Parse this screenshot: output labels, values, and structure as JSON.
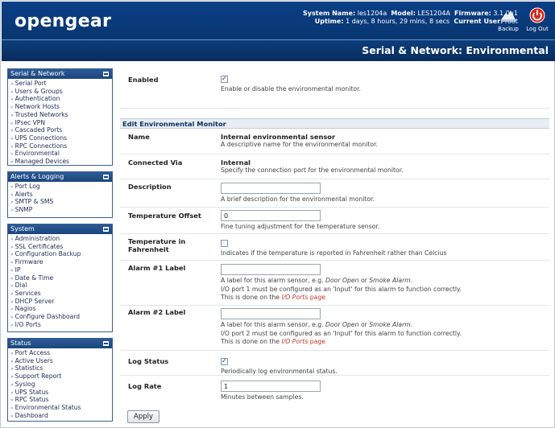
{
  "header": {
    "logo": "opengear",
    "system_name_label": "System Name:",
    "system_name": "les1204a",
    "model_label": "Model:",
    "model": "LES1204A",
    "firmware_label": "Firmware:",
    "firmware": "3.1.0u1",
    "uptime_label": "Uptime:",
    "uptime": "1 days, 8 hours, 29 mins, 8 secs",
    "current_user_label": "Current User:",
    "current_user": "root",
    "backup_label": "Backup",
    "logout_label": "Log Out"
  },
  "page_title": "Serial & Network: Environmental",
  "sidebar": {
    "serial_network": {
      "title": "Serial & Network",
      "items": [
        "Serial Port",
        "Users & Groups",
        "Authentication",
        "Network Hosts",
        "Trusted Networks",
        "IPsec VPN",
        "Cascaded Ports",
        "UPS Connections",
        "RPC Connections",
        "Environmental",
        "Managed Devices"
      ]
    },
    "alerts_logging": {
      "title": "Alerts & Logging",
      "items": [
        "Port Log",
        "Alerts",
        "SMTP & SMS",
        "SNMP"
      ]
    },
    "system": {
      "title": "System",
      "items": [
        "Administration",
        "SSL Certificates",
        "Configuration Backup",
        "Firmware",
        "IP",
        "Date & Time",
        "Dial",
        "Services",
        "DHCP Server",
        "Nagios",
        "Configure Dashboard",
        "I/O Ports"
      ]
    },
    "status": {
      "title": "Status",
      "items": [
        "Port Access",
        "Active Users",
        "Statistics",
        "Support Report",
        "Syslog",
        "UPS Status",
        "RPC Status",
        "Environmental Status",
        "Dashboard"
      ]
    }
  },
  "form": {
    "enabled": {
      "label": "Enabled",
      "checked": true,
      "hint": "Enable or disable the environmental monitor."
    },
    "section_title": "Edit Environmental Monitor",
    "name": {
      "label": "Name",
      "value": "Internal environmental sensor",
      "hint": "A descriptive name for the environmental monitor."
    },
    "connected_via": {
      "label": "Connected Via",
      "value": "Internal",
      "hint": "Specify the connection port for the environmental monitor."
    },
    "description": {
      "label": "Description",
      "value": "",
      "hint": "A brief description for the environmental monitor."
    },
    "temperature_offset": {
      "label": "Temperature Offset",
      "value": "0",
      "hint": "Fine tuning adjustment for the temperature sensor."
    },
    "fahrenheit": {
      "label": "Temperature in Fahrenheit",
      "checked": false,
      "hint": "Indicates if the temperature is reported in Fahrenheit rather than Celcius"
    },
    "alarm1": {
      "label": "Alarm #1 Label",
      "value": "",
      "hint1_pre": "A label for this alarm sensor, e.g. ",
      "hint1_em1": "Door Open",
      "hint1_mid": " or ",
      "hint1_em2": "Smoke Alarm",
      "hint1_post": ".",
      "hint2": "I/O port 1 must be configured as an 'Input' for this alarm to function correctly.",
      "hint3_pre": "This is done on the ",
      "hint3_link": "I/O Ports",
      "hint3_post": " page"
    },
    "alarm2": {
      "label": "Alarm #2 Label",
      "value": "",
      "hint1_pre": "A label for this alarm sensor, e.g. ",
      "hint1_em1": "Door Open",
      "hint1_mid": " or ",
      "hint1_em2": "Smoke Alarm",
      "hint1_post": ".",
      "hint2": "I/O port 2 must be configured as an 'Input' for this alarm to function correctly.",
      "hint3_pre": "This is done on the ",
      "hint3_link": "I/O Ports",
      "hint3_post": " page"
    },
    "log_status": {
      "label": "Log Status",
      "checked": true,
      "hint": "Periodically log environmental status."
    },
    "log_rate": {
      "label": "Log Rate",
      "value": "1",
      "hint": "Minutes between samples."
    },
    "apply_label": "Apply"
  },
  "colors": {
    "header_bg": "#0a3f86",
    "link": "#c0392b"
  }
}
